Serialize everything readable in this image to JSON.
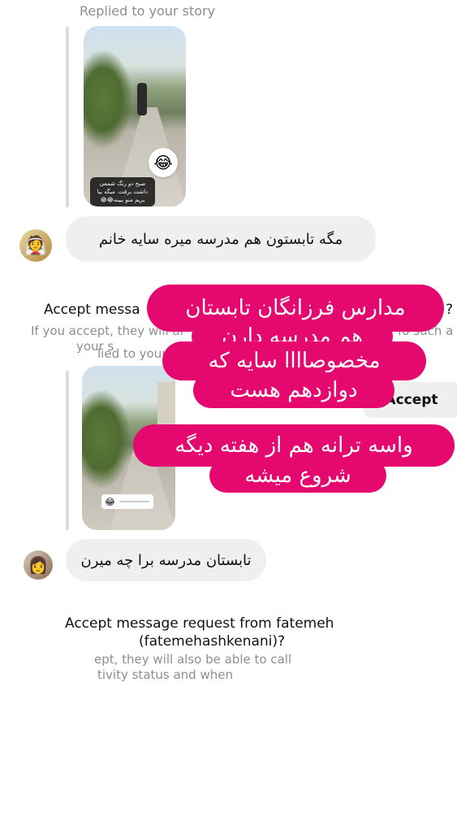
{
  "thread1": {
    "replied_label": "Replied to your story",
    "story_caption": "صبح دو رنگ شمعی داشت برفت. میگه بیا بریم منو ببینه😂😂",
    "reaction_emoji": "😂",
    "message": "مگه تابستون هم مدرسه میره سایه خانم",
    "avatar_emoji": "👰"
  },
  "request1": {
    "title": "Accept messa",
    "title_end": "?",
    "subtitle": "If you accept, they will al",
    "subtitle_end": "fo such a",
    "replied_label": "your s",
    "replied_label_b": "lied to your",
    "accept_label": "Accept"
  },
  "thread2": {
    "slider_emoji": "😂",
    "message": "تابستان مدرسه برا چه میرن",
    "avatar_emoji": "👩"
  },
  "request2": {
    "title": "Accept message request from fatemeh",
    "title_line2": "(fatemehashkenani)?",
    "subtitle_line1": "ept, they will also be able to call",
    "subtitle_line2": "tivity status and when"
  },
  "overlay": {
    "line1": "مدارس فرزانگان تابستان",
    "line2": "هم مدرسه دارن",
    "line3": "مخصوصاااا سایه که",
    "line4": "دوازدهم هست",
    "line5": "واسه ترانه هم از هفته دیگه",
    "line6": "شروع میشه"
  },
  "colors": {
    "sticker_pink": "#e5086f",
    "bubble_gray": "#efefef",
    "muted_text": "#8e8e8e"
  }
}
